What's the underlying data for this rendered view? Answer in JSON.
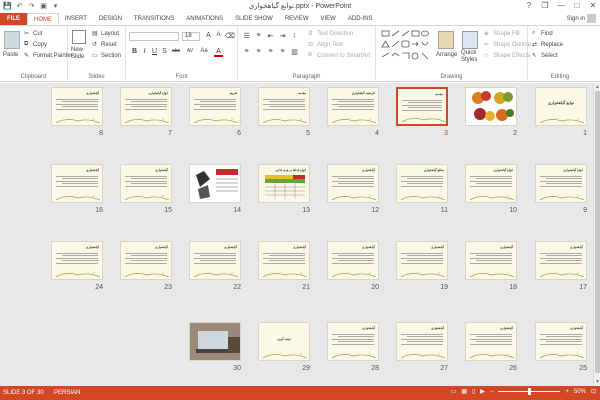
{
  "window": {
    "title": "نوابع گياهخواري.pptx - PowerPoint",
    "controls": [
      "?",
      "❐",
      "—",
      "□",
      "✕"
    ]
  },
  "quick_access": [
    "💾",
    "↶",
    "↷",
    "▣",
    "▾"
  ],
  "tabs": [
    "FILE",
    "HOME",
    "INSERT",
    "DESIGN",
    "TRANSITIONS",
    "ANIMATIONS",
    "SLIDE SHOW",
    "REVIEW",
    "VIEW",
    "ADD-INS"
  ],
  "active_tab": "HOME",
  "signin": "Sign in",
  "ribbon": {
    "clipboard": {
      "label": "Clipboard",
      "paste": "Paste",
      "cut": "Cut",
      "copy": "Copy",
      "format_painter": "Format Painter"
    },
    "slides": {
      "label": "Slides",
      "new_slide": "New Slide",
      "layout": "Layout",
      "reset": "Reset",
      "section": "Section"
    },
    "font": {
      "label": "Font",
      "font_name": "",
      "font_size": "18",
      "buttons": [
        "B",
        "I",
        "U",
        "S",
        "abc",
        "AV",
        "Aa",
        "A"
      ]
    },
    "paragraph": {
      "label": "Paragraph",
      "text_direction": "Text Direction",
      "align_text": "Align Text",
      "convert_smartart": "Convert to SmartArt"
    },
    "drawing": {
      "label": "Drawing",
      "arrange": "Arrange",
      "quick_styles": "Quick Styles",
      "shape_fill": "Shape Fill",
      "shape_outline": "Shape Outline",
      "shape_effects": "Shape Effects"
    },
    "editing": {
      "label": "Editing",
      "find": "Find",
      "replace": "Replace",
      "select": "Select"
    }
  },
  "slides": [
    {
      "n": "1",
      "title": "نوابع گياهخواري"
    },
    {
      "n": "2",
      "title": ""
    },
    {
      "n": "3",
      "title": "مقدمه"
    },
    {
      "n": "4",
      "title": "تاريخچه گياهخواري"
    },
    {
      "n": "5",
      "title": "مقدمه"
    },
    {
      "n": "6",
      "title": "تعريف"
    },
    {
      "n": "7",
      "title": "انواع گياهخواري"
    },
    {
      "n": "8",
      "title": "گياهخواري"
    },
    {
      "n": "9",
      "title": "انواع گياهخواري"
    },
    {
      "n": "10",
      "title": "انواع گياهخواري"
    },
    {
      "n": "11",
      "title": "منافع گياهخواري"
    },
    {
      "n": "12",
      "title": "گياهخواري"
    },
    {
      "n": "13",
      "title": "انواع غذاها در هرم غذايي"
    },
    {
      "n": "14",
      "title": ""
    },
    {
      "n": "15",
      "title": "گياهخواري"
    },
    {
      "n": "16",
      "title": "گياهخواري"
    },
    {
      "n": "17",
      "title": "گياهخواري"
    },
    {
      "n": "18",
      "title": "گياهخواري"
    },
    {
      "n": "19",
      "title": "گياهخواري"
    },
    {
      "n": "20",
      "title": "گياهخواري"
    },
    {
      "n": "21",
      "title": "گياهخواري"
    },
    {
      "n": "22",
      "title": "گياهخواري"
    },
    {
      "n": "23",
      "title": "گياهخواري"
    },
    {
      "n": "24",
      "title": "گياهخواري"
    },
    {
      "n": "25",
      "title": "گياهخواري"
    },
    {
      "n": "26",
      "title": "گياهخواري"
    },
    {
      "n": "27",
      "title": "گياهخواري"
    },
    {
      "n": "28",
      "title": "گياهخواري"
    },
    {
      "n": "29",
      "title": "نتيجه گيري"
    },
    {
      "n": "30",
      "title": ""
    }
  ],
  "selected_slide": "3",
  "status": {
    "slide_info": "SLIDE 3 OF 30",
    "language": "PERSIAN",
    "zoom": "50%",
    "minus": "−",
    "plus": "+"
  },
  "colors": {
    "accent": "#d24726",
    "sorter_bg": "#e8e8e8",
    "slide_bg": "#fbf8e8"
  }
}
